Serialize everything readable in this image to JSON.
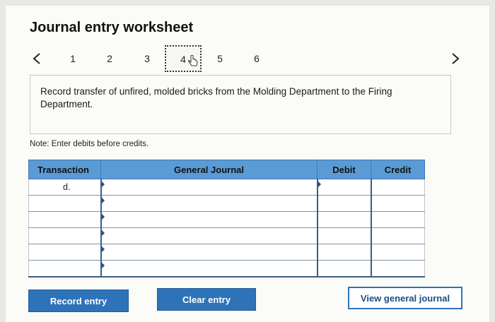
{
  "worksheet": {
    "title": "Journal entry worksheet"
  },
  "pager": {
    "pages": [
      "1",
      "2",
      "3",
      "4",
      "5",
      "6"
    ],
    "active_page": "4"
  },
  "prompt": {
    "text": "Record transfer of unfired, molded bricks from the Molding Department to the Firing Department."
  },
  "note": "Note: Enter debits before credits.",
  "table": {
    "headers": {
      "transaction": "Transaction",
      "general_journal": "General Journal",
      "debit": "Debit",
      "credit": "Credit"
    },
    "rows": [
      {
        "transaction": "d.",
        "account": "",
        "debit": "",
        "credit": ""
      },
      {
        "transaction": "",
        "account": "",
        "debit": "",
        "credit": ""
      },
      {
        "transaction": "",
        "account": "",
        "debit": "",
        "credit": ""
      },
      {
        "transaction": "",
        "account": "",
        "debit": "",
        "credit": ""
      },
      {
        "transaction": "",
        "account": "",
        "debit": "",
        "credit": ""
      },
      {
        "transaction": "",
        "account": "",
        "debit": "",
        "credit": ""
      }
    ]
  },
  "buttons": {
    "record": "Record entry",
    "clear": "Clear entry",
    "view": "View general journal"
  },
  "icons": {
    "prev": "chevron-left-icon",
    "next": "chevron-right-icon",
    "cursor": "hand-pointer-icon"
  },
  "colors": {
    "header_blue": "#5b9bd5",
    "button_blue": "#2e73b8"
  }
}
